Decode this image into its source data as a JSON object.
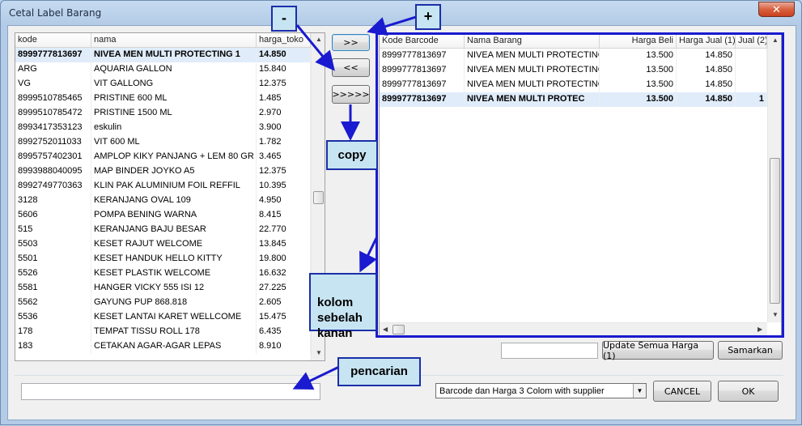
{
  "window": {
    "title": "Cetal Label Barang",
    "close_glyph": "✕"
  },
  "left_list": {
    "headers": [
      "kode",
      "nama",
      "harga_toko"
    ],
    "rows": [
      [
        "8999777813697",
        "NIVEA MEN MULTI PROTECTING 1",
        "14.850"
      ],
      [
        "ARG",
        "AQUARIA GALLON",
        "15.840"
      ],
      [
        "VG",
        "VIT GALLONG",
        "12.375"
      ],
      [
        "8999510785465",
        "PRISTINE 600 ML",
        "1.485"
      ],
      [
        "8999510785472",
        "PRISTINE 1500 ML",
        "2.970"
      ],
      [
        "8993417353123",
        "eskulin",
        "3.900"
      ],
      [
        "8992752011033",
        "VIT 600 ML",
        "1.782"
      ],
      [
        "8995757402301",
        "AMPLOP KIKY PANJANG + LEM 80 GR",
        "3.465"
      ],
      [
        "8993988040095",
        "MAP BINDER JOYKO A5",
        "12.375"
      ],
      [
        "8992749770363",
        "KLIN PAK ALUMINIUM FOIL REFFIL",
        "10.395"
      ],
      [
        "3128",
        "KERANJANG OVAL 109",
        "4.950"
      ],
      [
        "5606",
        "POMPA BENING WARNA",
        "8.415"
      ],
      [
        "515",
        "KERANJANG BAJU BESAR",
        "22.770"
      ],
      [
        "5503",
        "KESET RAJUT WELCOME",
        "13.845"
      ],
      [
        "5501",
        "KESET HANDUK HELLO KITTY",
        "19.800"
      ],
      [
        "5526",
        "KESET PLASTIK WELCOME",
        "16.632"
      ],
      [
        "5581",
        "HANGER VICKY 555 ISI 12",
        "27.225"
      ],
      [
        "5562",
        "GAYUNG PUP 868.818",
        "2.605"
      ],
      [
        "5536",
        "KESET LANTAI KARET WELLCOME",
        "15.475"
      ],
      [
        "178",
        "TEMPAT TISSU ROLL 178",
        "6.435"
      ],
      [
        "183",
        "CETAKAN AGAR-AGAR LEPAS",
        "8.910"
      ]
    ]
  },
  "middle_buttons": {
    "add": ">>",
    "remove": "<<",
    "copy": ">>>>>"
  },
  "right_list": {
    "headers": [
      "Kode Barcode",
      "Nama Barang",
      "Harga Beli",
      "Harga Jual (1)",
      "Jual (2)"
    ],
    "rows": [
      [
        "8999777813697",
        "NIVEA MEN MULTI PROTECTING",
        "13.500",
        "14.850",
        ""
      ],
      [
        "8999777813697",
        "NIVEA MEN MULTI PROTECTING",
        "13.500",
        "14.850",
        ""
      ],
      [
        "8999777813697",
        "NIVEA MEN MULTI PROTECTING",
        "13.500",
        "14.850",
        ""
      ],
      [
        "8999777813697",
        "NIVEA MEN MULTI PROTEC",
        "13.500",
        "14.850",
        "1"
      ]
    ]
  },
  "bottom_right": {
    "price_input_value": "",
    "update_button": "Update Semua Harga (1)",
    "equalize_button": "Samarkan"
  },
  "footer": {
    "search_value": "",
    "template_select": "Barcode dan Harga 3 Colom with supplier",
    "cancel_button": "CANCEL",
    "ok_button": "OK"
  },
  "annotations": {
    "minus": "-",
    "plus": "+",
    "copy": "copy",
    "right_column": "kolom\nsebelah\nkanan",
    "search": "pencarian"
  },
  "colors": {
    "annotation_blue": "#1a1ad0",
    "callout_bg": "#c7e4f2",
    "selected_row": "#e0ecfa"
  }
}
